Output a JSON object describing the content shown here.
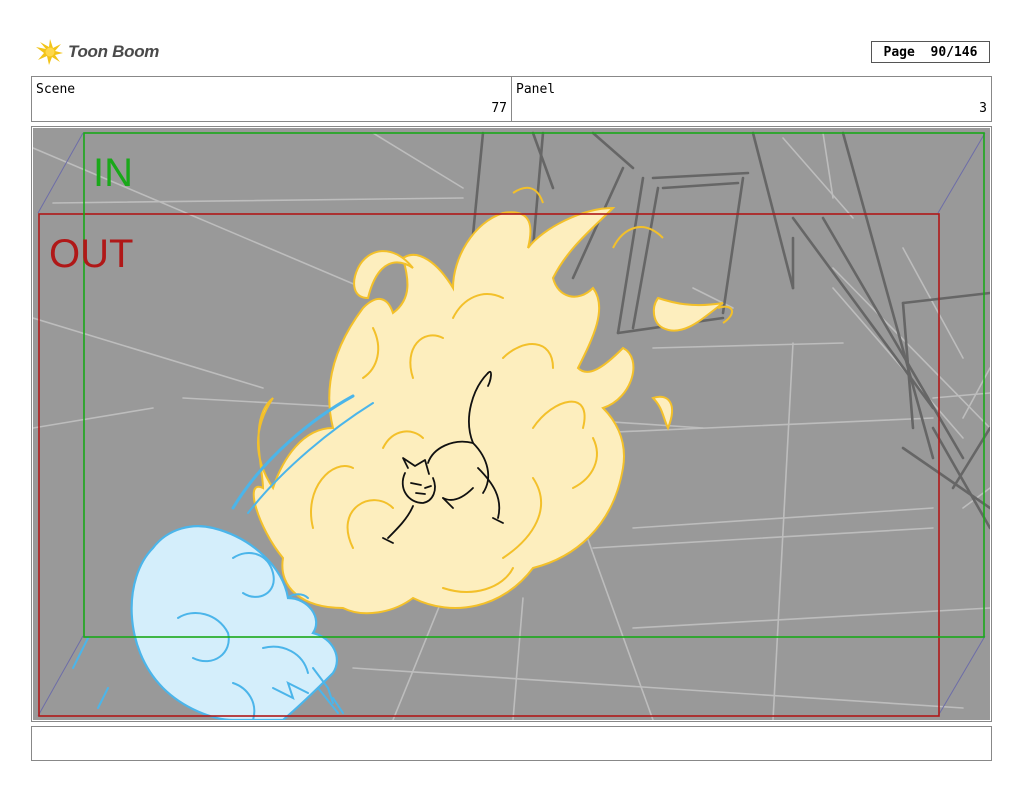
{
  "brand": {
    "name": "Toon Boom",
    "accent": "#f2c418"
  },
  "page": {
    "label": "Page",
    "value": "90/146"
  },
  "scene": {
    "label": "Scene",
    "value": "77"
  },
  "panel": {
    "label": "Panel",
    "value": "3"
  },
  "frame_labels": {
    "in": "IN",
    "out": "OUT"
  },
  "colors": {
    "in_frame": "#1aa81a",
    "out_frame": "#b01818",
    "background": "#999999",
    "flame_fill": "#fdeebe",
    "flame_line": "#f3c02a",
    "mouse_fill": "#d4eefb",
    "mouse_line": "#4bb5ea"
  }
}
